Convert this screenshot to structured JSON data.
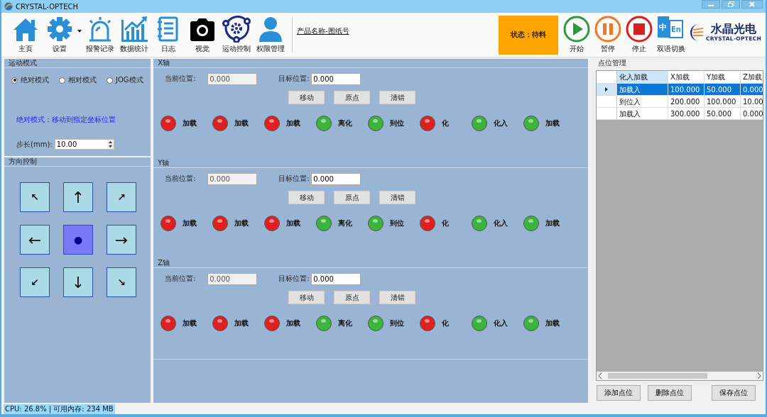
{
  "window": {
    "title": "CRYSTAL-OPTECH"
  },
  "toolbar": {
    "items": [
      {
        "label": "主页",
        "kind": "home",
        "dropdown": false
      },
      {
        "label": "设置",
        "kind": "gear",
        "dropdown": true
      },
      {
        "label": "报警记录",
        "kind": "alarm",
        "dropdown": false
      },
      {
        "label": "数据统计",
        "kind": "chart",
        "dropdown": false
      },
      {
        "label": "日志",
        "kind": "log",
        "dropdown": false
      },
      {
        "label": "视觉",
        "kind": "camera",
        "dropdown": false
      },
      {
        "label": "运动控制",
        "kind": "motion",
        "dropdown": false
      },
      {
        "label": "权限管理",
        "kind": "user",
        "dropdown": false
      }
    ],
    "product_link": "产品名称-图纸号",
    "status": "状态：待料",
    "controls": [
      {
        "label": "开始",
        "kind": "play"
      },
      {
        "label": "暂停",
        "kind": "pause"
      },
      {
        "label": "停止",
        "kind": "stop"
      }
    ],
    "language": {
      "label": "双语切换",
      "icon_texts": [
        "中",
        "En"
      ]
    },
    "logo": {
      "name": "水晶光电",
      "subtitle": "CRYSTAL-OPTECH"
    }
  },
  "motion_mode": {
    "title": "运动模式",
    "options": [
      {
        "label": "绝对模式",
        "selected": true
      },
      {
        "label": "相对模式",
        "selected": false
      },
      {
        "label": "JOG模式",
        "selected": false
      }
    ],
    "hint": "绝对模式：移动到指定坐标位置",
    "step": {
      "label": "步长(mm):",
      "value": "10.00"
    }
  },
  "direction": {
    "title": "方向控制",
    "buttons": [
      {
        "label": "↖",
        "kind": "small"
      },
      {
        "label": "↑",
        "kind": "large"
      },
      {
        "label": "↗",
        "kind": "small"
      },
      {
        "label": "←",
        "kind": "large"
      },
      {
        "label": "●",
        "kind": "center"
      },
      {
        "label": "→",
        "kind": "large"
      },
      {
        "label": "↙",
        "kind": "small"
      },
      {
        "label": "↓",
        "kind": "large"
      },
      {
        "label": "↘",
        "kind": "small"
      }
    ]
  },
  "axes": [
    {
      "title": "X轴",
      "current": {
        "label": "当前位置:",
        "value": "0.000",
        "disabled": true
      },
      "target": {
        "label": "目标位置:",
        "value": "0.000",
        "disabled": false
      },
      "buttons": [
        "移动",
        "原点",
        "清错"
      ],
      "lamps": [
        {
          "label": "加载",
          "color": "#e02020"
        },
        {
          "label": "加载",
          "color": "#e02020"
        },
        {
          "label": "加载",
          "color": "#e02020"
        },
        {
          "label": "离化",
          "color": "#3cb43c"
        },
        {
          "label": "到位",
          "color": "#3cb43c"
        },
        {
          "label": "化",
          "color": "#e02020"
        },
        {
          "label": "化入",
          "color": "#3cb43c"
        },
        {
          "label": "加载",
          "color": "#3cb43c"
        }
      ]
    },
    {
      "title": "Y轴",
      "current": {
        "label": "当前位置:",
        "value": "0.000",
        "disabled": true
      },
      "target": {
        "label": "目标位置:",
        "value": "0.000",
        "disabled": false
      },
      "buttons": [
        "移动",
        "原点",
        "清错"
      ],
      "lamps": [
        {
          "label": "加载",
          "color": "#e02020"
        },
        {
          "label": "加载",
          "color": "#e02020"
        },
        {
          "label": "加载",
          "color": "#e02020"
        },
        {
          "label": "离化",
          "color": "#3cb43c"
        },
        {
          "label": "到位",
          "color": "#3cb43c"
        },
        {
          "label": "化",
          "color": "#e02020"
        },
        {
          "label": "化入",
          "color": "#3cb43c"
        },
        {
          "label": "加载",
          "color": "#3cb43c"
        }
      ]
    },
    {
      "title": "Z轴",
      "current": {
        "label": "当前位置:",
        "value": "0.000",
        "disabled": true
      },
      "target": {
        "label": "目标位置:",
        "value": "0.000",
        "disabled": false
      },
      "buttons": [
        "移动",
        "原点",
        "清错"
      ],
      "lamps": [
        {
          "label": "加载",
          "color": "#e02020"
        },
        {
          "label": "加载",
          "color": "#e02020"
        },
        {
          "label": "加载",
          "color": "#e02020"
        },
        {
          "label": "离化",
          "color": "#3cb43c"
        },
        {
          "label": "到位",
          "color": "#3cb43c"
        },
        {
          "label": "化",
          "color": "#e02020"
        },
        {
          "label": "化入",
          "color": "#3cb43c"
        },
        {
          "label": "加载",
          "color": "#3cb43c"
        }
      ]
    }
  ],
  "points": {
    "title": "点位管理",
    "columns": [
      "化入加载",
      "X加载",
      "Y加载",
      "Z加载"
    ],
    "rows": [
      {
        "cells": [
          "加载入",
          "100.000",
          "50.000",
          "0.000"
        ],
        "selected": true
      },
      {
        "cells": [
          "到位入",
          "200.000",
          "100.000",
          "10.00"
        ],
        "selected": false
      },
      {
        "cells": [
          "加载入",
          "300.000",
          "50.000",
          "0.000"
        ],
        "selected": false
      }
    ],
    "buttons": [
      "添加点位",
      "删除点位",
      "保存点位"
    ]
  },
  "status_bar": "CPU: 26.8% | 可用内存: 234 MB"
}
